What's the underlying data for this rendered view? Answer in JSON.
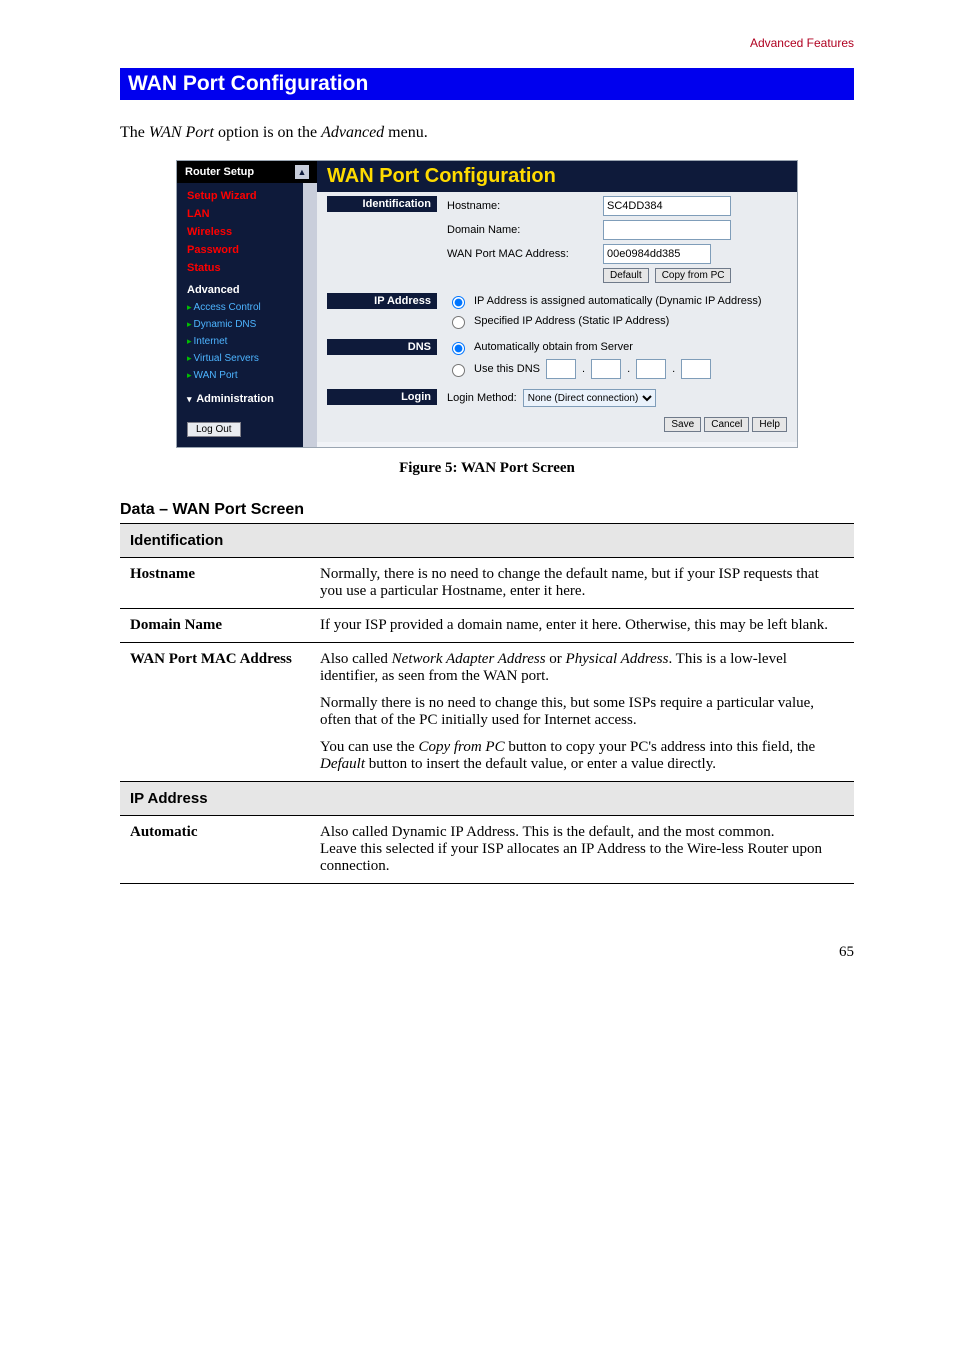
{
  "header": {
    "breadcrumb": "Advanced Features"
  },
  "section": {
    "title": "WAN Port Configuration",
    "intro_pre": "The ",
    "intro_em1": "WAN Port",
    "intro_mid": " option is on the ",
    "intro_em2": "Advanced",
    "intro_post": " menu."
  },
  "shot": {
    "router_setup": "Router Setup",
    "nav": {
      "setup_wizard": "Setup Wizard",
      "lan": "LAN",
      "wireless": "Wireless",
      "password": "Password",
      "status": "Status",
      "advanced": "Advanced",
      "access_control": "Access Control",
      "dynamic_dns": "Dynamic DNS",
      "internet": "Internet",
      "virtual_servers": "Virtual Servers",
      "wan_port": "WAN Port",
      "administration": "Administration",
      "logout": "Log Out"
    },
    "panel_title": "WAN Port Configuration",
    "identification": {
      "label": "Identification",
      "hostname_label": "Hostname:",
      "hostname_value": "SC4DD384",
      "domain_label": "Domain Name:",
      "mac_label_pre": "WAN Port MAC Address:",
      "mac_value": "00e0984dd385",
      "default_btn": "Default",
      "copy_btn": "Copy from PC"
    },
    "ip": {
      "label": "IP Address",
      "opt_dynamic": "IP Address is assigned automatically (Dynamic IP Address)",
      "opt_static": "Specified IP Address (Static IP Address)"
    },
    "dns": {
      "label": "DNS",
      "opt_auto": "Automatically obtain from Server",
      "opt_use": "Use this DNS"
    },
    "login": {
      "label": "Login",
      "method_label": "Login Method:",
      "method_value": "None (Direct connection)"
    },
    "buttons": {
      "save": "Save",
      "cancel": "Cancel",
      "help": "Help"
    }
  },
  "caption": "Figure 5: WAN Port Screen",
  "data_title": "Data – WAN Port Screen",
  "table": {
    "identification_header": "Identification",
    "hostname_k": "Hostname",
    "hostname_v": "Normally, there is no need to change the default name, but if your ISP requests that you use a particular Hostname, enter it here.",
    "domain_k": "Domain Name",
    "domain_v": "If your ISP provided a domain name, enter it here. Otherwise, this may be left blank.",
    "mac_k": "WAN Port MAC Address",
    "mac_v1_pre": "Also called ",
    "mac_v1_em1": "Network Adapter Address",
    "mac_v1_mid": " or ",
    "mac_v1_em2": "Physical Address",
    "mac_v1_post": ". This is a low-level identifier, as seen from the WAN port.",
    "mac_v2": "Normally there is no need to change this, but some ISPs require a particular value, often that of the PC initially used for Internet access.",
    "mac_v3_pre": "You can use the ",
    "mac_v3_em1": "Copy from PC",
    "mac_v3_mid": " button to copy your PC's address into this field, the ",
    "mac_v3_em2": "Default",
    "mac_v3_post": " button to insert the default value, or enter a value directly.",
    "ip_header": "IP Address",
    "auto_k": "Automatic",
    "auto_v": "Also called Dynamic IP Address. This is the default, and the most common.\nLeave this selected if your ISP allocates an IP Address to the Wire-less Router upon connection."
  },
  "page_number": "65"
}
